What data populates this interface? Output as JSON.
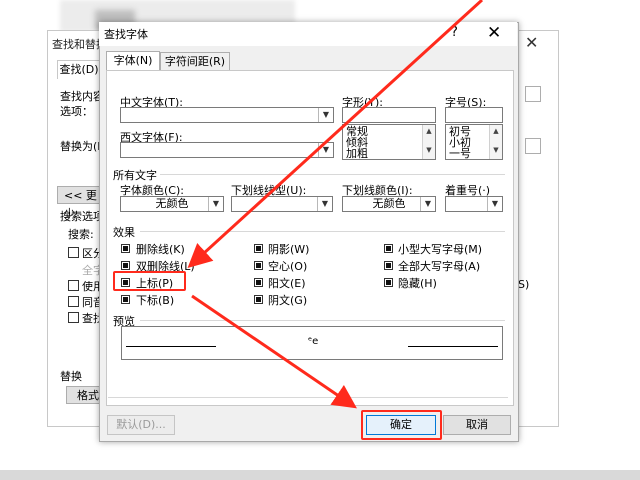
{
  "background_dialog": {
    "title": "查找和替换",
    "close_label": "✕",
    "tab_find": "查找(D)",
    "find_label": "查找内容",
    "options_label": "选项：",
    "replace_label": "替换为(I)",
    "more_button": "<< 更少",
    "search_options_label": "搜索选项",
    "search_label": "搜索:",
    "checkboxes": [
      "区分",
      "全字",
      "使用",
      "同音",
      "查找"
    ],
    "replace_section_label": "替换",
    "format_button": "格式",
    "right_fragment": "S)"
  },
  "dialog": {
    "title": "查找字体",
    "help_label": "?",
    "close_label": "✕",
    "tabs": [
      {
        "label": "字体(N)"
      },
      {
        "label": "字符间距(R)"
      }
    ],
    "chinese_font_label": "中文字体(T):",
    "chinese_font_value": "",
    "western_font_label": "西文字体(F):",
    "western_font_value": "",
    "style_label": "字形(Y):",
    "style_options": [
      "常规",
      "倾斜",
      "加粗"
    ],
    "size_label": "字号(S):",
    "size_options": [
      "初号",
      "小初",
      "一号"
    ],
    "all_text_label": "所有文字",
    "font_color_label": "字体颜色(C):",
    "font_color_value": "无颜色",
    "underline_type_label": "下划线线型(U):",
    "underline_type_value": "",
    "underline_color_label": "下划线颜色(I):",
    "underline_color_value": "无颜色",
    "emphasis_label": "着重号(·)",
    "emphasis_value": "",
    "effects_label": "效果",
    "effects": [
      {
        "label": "删除线(K)"
      },
      {
        "label": "阴影(W)"
      },
      {
        "label": "小型大写字母(M)"
      },
      {
        "label": "双删除线(L)"
      },
      {
        "label": "空心(O)"
      },
      {
        "label": "全部大写字母(A)"
      },
      {
        "label": "上标(P)"
      },
      {
        "label": "阳文(E)"
      },
      {
        "label": "隐藏(H)"
      },
      {
        "label": "下标(B)"
      },
      {
        "label": "阴文(G)"
      }
    ],
    "preview_label": "预览",
    "preview_text": "ᵉe",
    "default_button": "默认(D)...",
    "ok_button": "确定",
    "cancel_button": "取消"
  },
  "colors": {
    "highlight": "#ff2a1c",
    "primary_button_border": "#0078d7"
  }
}
